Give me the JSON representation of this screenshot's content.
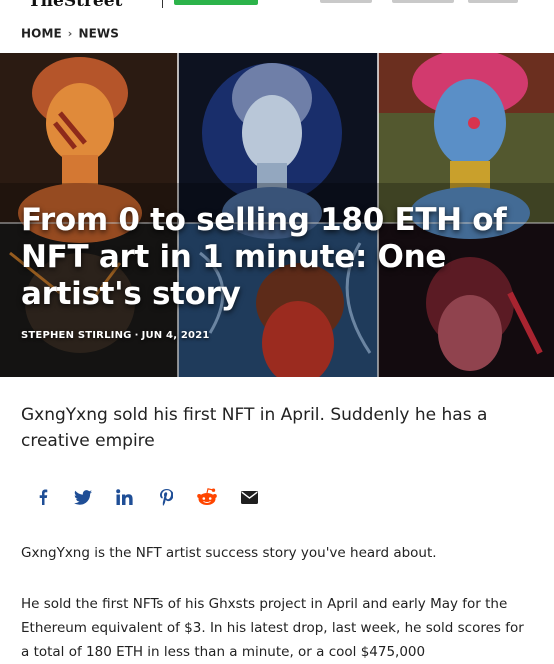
{
  "breadcrumb": {
    "home": "HOME",
    "section": "NEWS"
  },
  "article": {
    "title": "From 0 to selling 180 ETH of NFT art in 1 minute: One artist's story",
    "author": "STEPHEN STIRLING",
    "date": "JUN 4, 2021",
    "subtitle": "GxngYxng sold his first NFT in April. Suddenly he has a creative empire",
    "paragraphs": [
      "GxngYxng is the NFT artist success story you've heard about.",
      "He sold the first NFTs of his Ghxsts project in April and early May for the Ethereum equivalent of $3. In his latest drop, last week, he sold scores for a total of 180 ETH in less than a minute, or a cool $475,000"
    ]
  },
  "share": {
    "icons": [
      "facebook-icon",
      "twitter-icon",
      "linkedin-icon",
      "pinterest-icon",
      "reddit-icon",
      "email-icon"
    ],
    "color": "#1f4e96",
    "reddit_color": "#ff4500"
  },
  "colors": {
    "cta": "#2cb34a"
  }
}
